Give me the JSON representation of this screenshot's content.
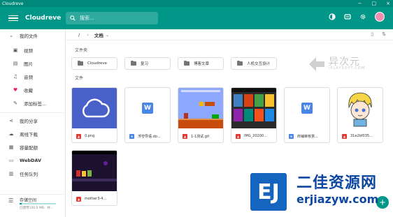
{
  "window": {
    "title": "Cloudreve",
    "controls": [
      "−",
      "□",
      "×"
    ]
  },
  "appbar": {
    "title": "Cloudreve",
    "search_placeholder": "搜索...",
    "icons": [
      "theme-icon",
      "grid-icon",
      "settings-icon",
      "avatar"
    ]
  },
  "sidebar": {
    "my_files": "我的文件",
    "sub_items": [
      {
        "label": "视频",
        "icon": "video-icon"
      },
      {
        "label": "图片",
        "icon": "image-icon"
      },
      {
        "label": "音频",
        "icon": "music-icon"
      },
      {
        "label": "收藏",
        "icon": "heart-icon"
      },
      {
        "label": "添加标签...",
        "icon": "add-icon"
      }
    ],
    "items": [
      {
        "label": "我的分享",
        "icon": "share-icon"
      },
      {
        "label": "离线下载",
        "icon": "download-icon"
      },
      {
        "label": "容量配额",
        "icon": "storage-icon"
      },
      {
        "label": "WebDAV",
        "icon": "webdav-icon"
      },
      {
        "label": "任务队列",
        "icon": "queue-icon"
      }
    ],
    "storage": {
      "label": "存储空间",
      "text": "已使用100.0 MB，共...",
      "used_fraction": 0.05
    }
  },
  "toolbar": {
    "root": "/",
    "current": "文档",
    "icons": [
      "view-icon",
      "sort-icon"
    ]
  },
  "folders_label": "文件夹",
  "folders": [
    "Cloudreve",
    "复习",
    "博客文章",
    "人机交互设计"
  ],
  "files_label": "文件",
  "files": [
    {
      "name": "0.png",
      "type": "image",
      "thumb": "cloud"
    },
    {
      "name": "浮夸导语.do...",
      "type": "doc",
      "thumb": "word"
    },
    {
      "name": "1-1测试.gif",
      "type": "image",
      "thumb": "game"
    },
    {
      "name": "IMG_20200...",
      "type": "image",
      "thumb": "phone"
    },
    {
      "name": "商铺审核意...",
      "type": "doc",
      "thumb": "word"
    },
    {
      "name": "31e2bf035...",
      "type": "image",
      "thumb": "anime"
    },
    {
      "name": "mother3-4...",
      "type": "image",
      "thumb": "dark"
    }
  ],
  "fab": "+",
  "watermark_top": {
    "big": "异次元",
    "small": "IPLAYSOFT.COM"
  },
  "watermark_bottom": {
    "logo": "EJ",
    "title": "二佳资源网",
    "url": "erjiazyw.com"
  },
  "colors": {
    "primary": "#009688",
    "primary_dark": "#00897b",
    "doc": "#4a86e8",
    "image": "#e53935"
  }
}
